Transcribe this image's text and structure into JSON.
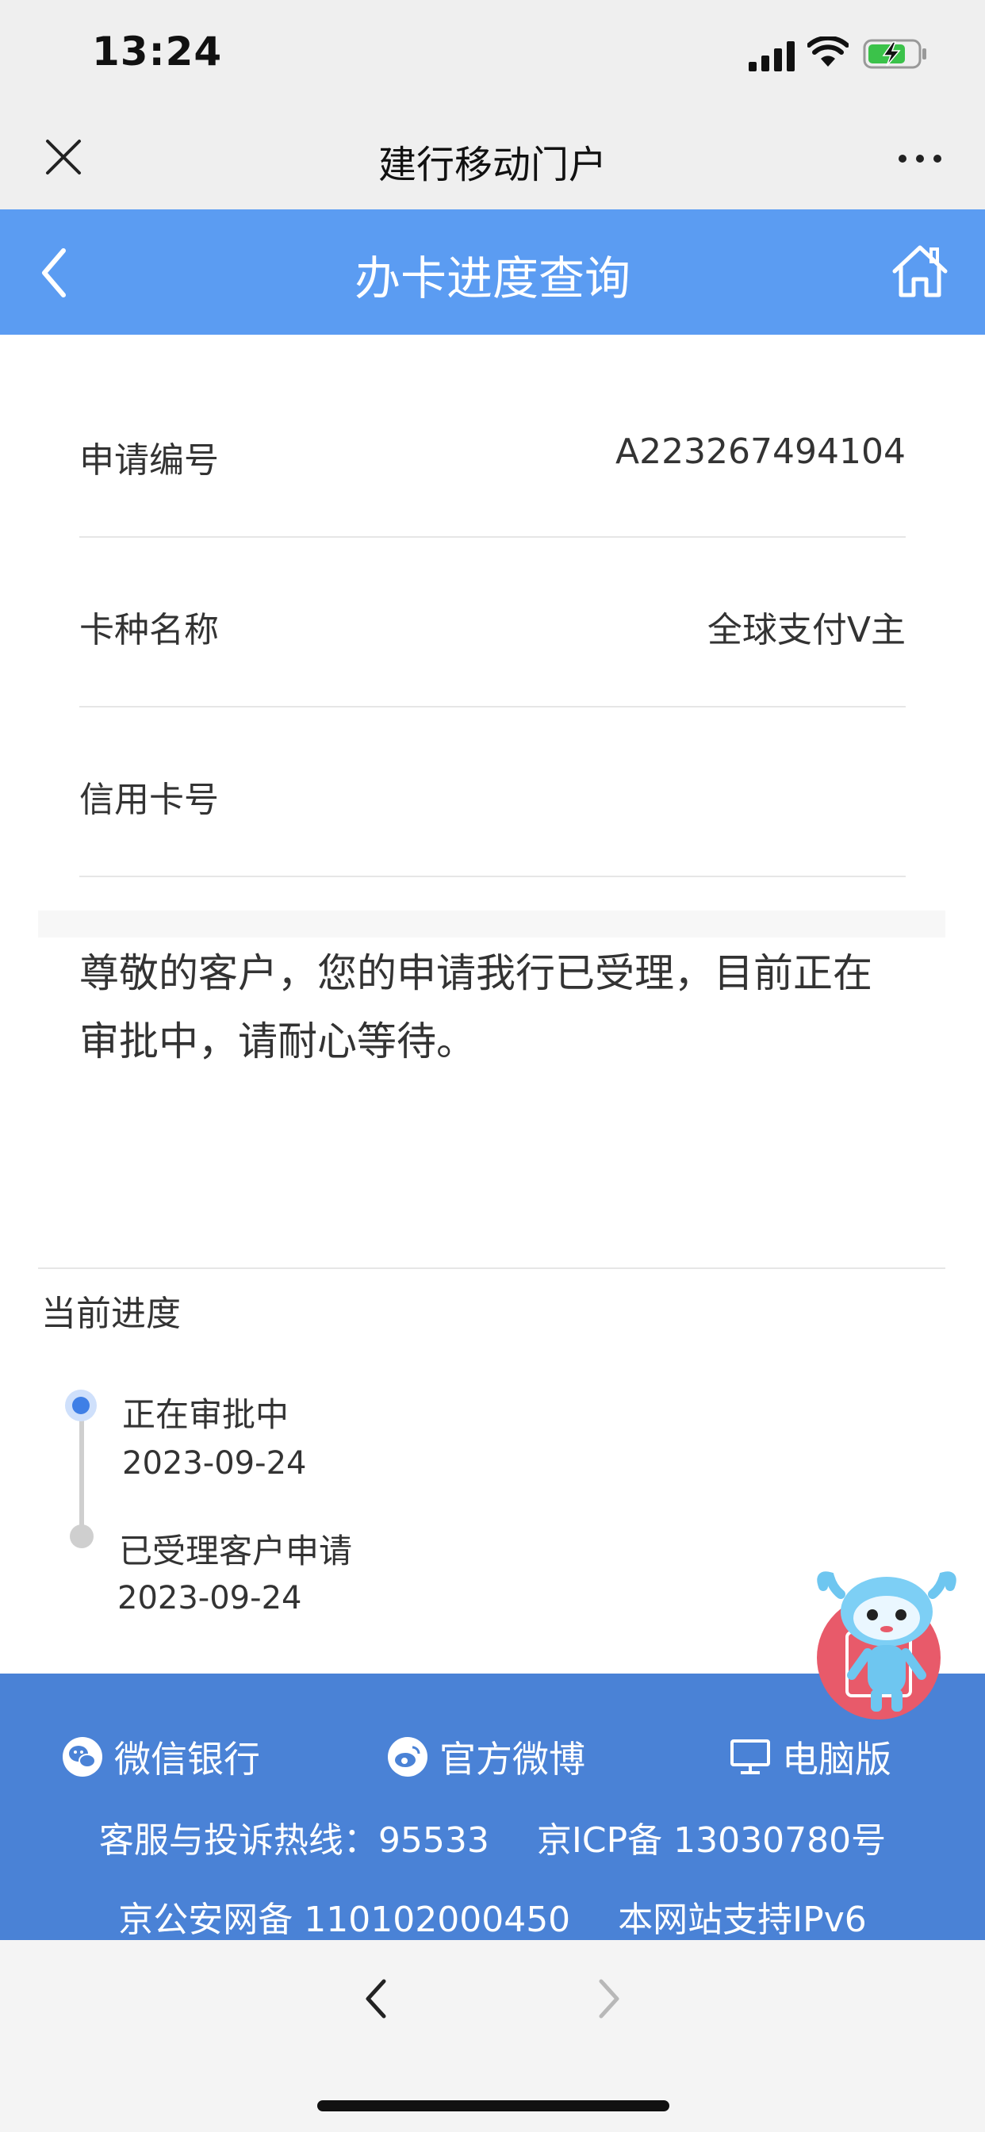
{
  "status_bar": {
    "time": "13:24"
  },
  "window": {
    "title": "建行移动门户"
  },
  "header": {
    "title": "办卡进度查询"
  },
  "info_rows": [
    {
      "label": "申请编号",
      "value": "A223267494104"
    },
    {
      "label": "卡种名称",
      "value": "全球支付V主"
    },
    {
      "label": "信用卡号",
      "value": ""
    }
  ],
  "notice": "尊敬的客户，您的申请我行已受理，目前正在审批中，请耐心等待。",
  "progress": {
    "title": "当前进度",
    "steps": [
      {
        "name": "正在审批中",
        "date": "2023-09-24",
        "state": "active"
      },
      {
        "name": "已受理客户申请",
        "date": "2023-09-24",
        "state": "done"
      }
    ]
  },
  "footer": {
    "links": [
      {
        "label": "微信银行",
        "icon": "wechat-icon"
      },
      {
        "label": "官方微博",
        "icon": "weibo-icon"
      },
      {
        "label": "电脑版",
        "icon": "monitor-icon"
      }
    ],
    "hotline": "客服与投诉热线：95533",
    "icp": "京ICP备 13030780号",
    "police": "京公安网备 110102000450",
    "ipv6": "本网站支持IPv6"
  },
  "colors": {
    "header_bg": "#5b9cf2",
    "footer_bg": "#4a82d6",
    "active_dot": "#3f7fe6"
  }
}
